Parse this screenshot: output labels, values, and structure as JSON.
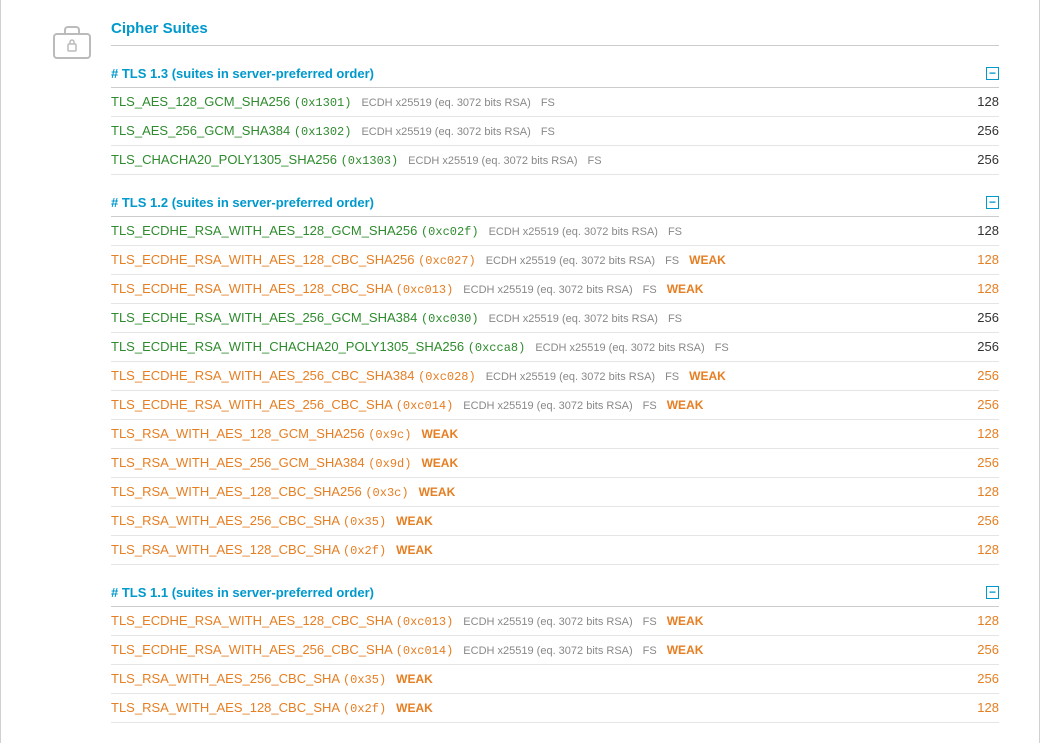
{
  "section_title": "Cipher Suites",
  "toggle_glyph": "−",
  "groups": [
    {
      "id": "tls13",
      "label": "# TLS 1.3 (suites in server-preferred order)",
      "rows": [
        {
          "name": "TLS_AES_128_GCM_SHA256",
          "hex": "(0x1301)",
          "details": "ECDH x25519 (eq. 3072 bits RSA)",
          "fs": "FS",
          "weak": "",
          "strength": "128",
          "cls": "green",
          "scls": "black"
        },
        {
          "name": "TLS_AES_256_GCM_SHA384",
          "hex": "(0x1302)",
          "details": "ECDH x25519 (eq. 3072 bits RSA)",
          "fs": "FS",
          "weak": "",
          "strength": "256",
          "cls": "green",
          "scls": "black"
        },
        {
          "name": "TLS_CHACHA20_POLY1305_SHA256",
          "hex": "(0x1303)",
          "details": "ECDH x25519 (eq. 3072 bits RSA)",
          "fs": "FS",
          "weak": "",
          "strength": "256",
          "cls": "green",
          "scls": "black"
        }
      ]
    },
    {
      "id": "tls12",
      "label": "# TLS 1.2 (suites in server-preferred order)",
      "rows": [
        {
          "name": "TLS_ECDHE_RSA_WITH_AES_128_GCM_SHA256",
          "hex": "(0xc02f)",
          "details": "ECDH x25519 (eq. 3072 bits RSA)",
          "fs": "FS",
          "weak": "",
          "strength": "128",
          "cls": "green",
          "scls": "black"
        },
        {
          "name": "TLS_ECDHE_RSA_WITH_AES_128_CBC_SHA256",
          "hex": "(0xc027)",
          "details": "ECDH x25519 (eq. 3072 bits RSA)",
          "fs": "FS",
          "weak": "WEAK",
          "strength": "128",
          "cls": "orange",
          "scls": "orange"
        },
        {
          "name": "TLS_ECDHE_RSA_WITH_AES_128_CBC_SHA",
          "hex": "(0xc013)",
          "details": "ECDH x25519 (eq. 3072 bits RSA)",
          "fs": "FS",
          "weak": "WEAK",
          "strength": "128",
          "cls": "orange",
          "scls": "orange"
        },
        {
          "name": "TLS_ECDHE_RSA_WITH_AES_256_GCM_SHA384",
          "hex": "(0xc030)",
          "details": "ECDH x25519 (eq. 3072 bits RSA)",
          "fs": "FS",
          "weak": "",
          "strength": "256",
          "cls": "green",
          "scls": "black"
        },
        {
          "name": "TLS_ECDHE_RSA_WITH_CHACHA20_POLY1305_SHA256",
          "hex": "(0xcca8)",
          "details": "ECDH x25519 (eq. 3072 bits RSA)",
          "fs": "FS",
          "weak": "",
          "strength": "256",
          "cls": "green",
          "scls": "black"
        },
        {
          "name": "TLS_ECDHE_RSA_WITH_AES_256_CBC_SHA384",
          "hex": "(0xc028)",
          "details": "ECDH x25519 (eq. 3072 bits RSA)",
          "fs": "FS",
          "weak": "WEAK",
          "strength": "256",
          "cls": "orange",
          "scls": "orange"
        },
        {
          "name": "TLS_ECDHE_RSA_WITH_AES_256_CBC_SHA",
          "hex": "(0xc014)",
          "details": "ECDH x25519 (eq. 3072 bits RSA)",
          "fs": "FS",
          "weak": "WEAK",
          "strength": "256",
          "cls": "orange",
          "scls": "orange"
        },
        {
          "name": "TLS_RSA_WITH_AES_128_GCM_SHA256",
          "hex": "(0x9c)",
          "details": "",
          "fs": "",
          "weak": "WEAK",
          "strength": "128",
          "cls": "orange",
          "scls": "orange"
        },
        {
          "name": "TLS_RSA_WITH_AES_256_GCM_SHA384",
          "hex": "(0x9d)",
          "details": "",
          "fs": "",
          "weak": "WEAK",
          "strength": "256",
          "cls": "orange",
          "scls": "orange"
        },
        {
          "name": "TLS_RSA_WITH_AES_128_CBC_SHA256",
          "hex": "(0x3c)",
          "details": "",
          "fs": "",
          "weak": "WEAK",
          "strength": "128",
          "cls": "orange",
          "scls": "orange"
        },
        {
          "name": "TLS_RSA_WITH_AES_256_CBC_SHA",
          "hex": "(0x35)",
          "details": "",
          "fs": "",
          "weak": "WEAK",
          "strength": "256",
          "cls": "orange",
          "scls": "orange"
        },
        {
          "name": "TLS_RSA_WITH_AES_128_CBC_SHA",
          "hex": "(0x2f)",
          "details": "",
          "fs": "",
          "weak": "WEAK",
          "strength": "128",
          "cls": "orange",
          "scls": "orange"
        }
      ]
    },
    {
      "id": "tls11",
      "label": "# TLS 1.1 (suites in server-preferred order)",
      "rows": [
        {
          "name": "TLS_ECDHE_RSA_WITH_AES_128_CBC_SHA",
          "hex": "(0xc013)",
          "details": "ECDH x25519 (eq. 3072 bits RSA)",
          "fs": "FS",
          "weak": "WEAK",
          "strength": "128",
          "cls": "orange",
          "scls": "orange"
        },
        {
          "name": "TLS_ECDHE_RSA_WITH_AES_256_CBC_SHA",
          "hex": "(0xc014)",
          "details": "ECDH x25519 (eq. 3072 bits RSA)",
          "fs": "FS",
          "weak": "WEAK",
          "strength": "256",
          "cls": "orange",
          "scls": "orange"
        },
        {
          "name": "TLS_RSA_WITH_AES_256_CBC_SHA",
          "hex": "(0x35)",
          "details": "",
          "fs": "",
          "weak": "WEAK",
          "strength": "256",
          "cls": "orange",
          "scls": "orange"
        },
        {
          "name": "TLS_RSA_WITH_AES_128_CBC_SHA",
          "hex": "(0x2f)",
          "details": "",
          "fs": "",
          "weak": "WEAK",
          "strength": "128",
          "cls": "orange",
          "scls": "orange"
        }
      ]
    }
  ]
}
